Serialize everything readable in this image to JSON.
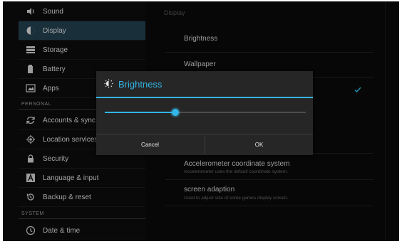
{
  "sidebar": {
    "items": [
      {
        "label": "Sound",
        "icon": "speaker-icon"
      },
      {
        "label": "Display",
        "icon": "brightness-icon",
        "active": true
      },
      {
        "label": "Storage",
        "icon": "storage-icon"
      },
      {
        "label": "Battery",
        "icon": "battery-icon"
      },
      {
        "label": "Apps",
        "icon": "apps-icon"
      }
    ],
    "header_personal": "PERSONAL",
    "personal_items": [
      {
        "label": "Accounts & sync",
        "icon": "sync-icon"
      },
      {
        "label": "Location services",
        "icon": "location-icon"
      },
      {
        "label": "Security",
        "icon": "lock-icon"
      },
      {
        "label": "Language & input",
        "icon": "keyboard-icon"
      },
      {
        "label": "Backup & reset",
        "icon": "backup-icon"
      }
    ],
    "header_system": "SYSTEM",
    "system_items": [
      {
        "label": "Date & time",
        "icon": "clock-icon"
      }
    ]
  },
  "content": {
    "title": "Display",
    "items": [
      {
        "label": "Brightness"
      },
      {
        "label": "Wallpaper"
      }
    ],
    "accelerometer": {
      "label": "Accelerometer coordinate system",
      "sub": "Accelerometer uses the default coordinate system."
    },
    "screen_adaption": {
      "label": "screen adaption",
      "sub": "Used to adjust size of some games display screen."
    }
  },
  "dialog": {
    "title": "Brightness",
    "slider_value": 0.35,
    "cancel_label": "Cancel",
    "ok_label": "OK"
  },
  "colors": {
    "accent": "#33b5e5",
    "active_bg": "#22414f"
  }
}
